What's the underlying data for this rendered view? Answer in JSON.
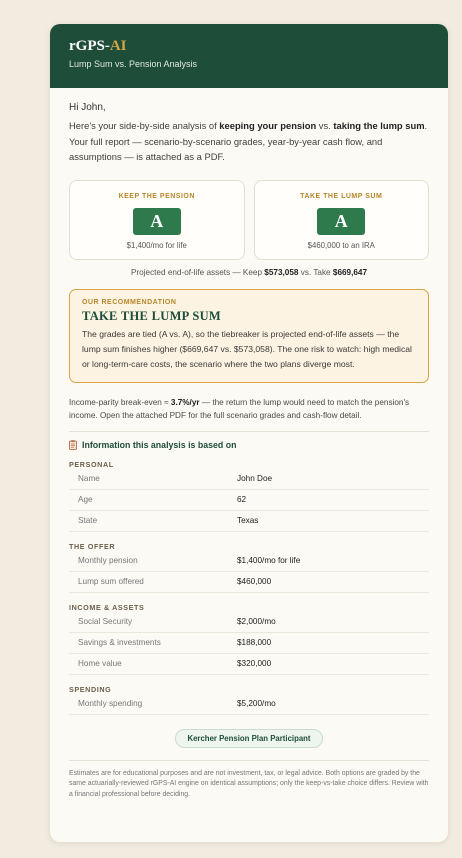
{
  "header": {
    "brand_main": "rGPS-",
    "brand_accent": "AI",
    "subtitle": "Lump Sum vs. Pension Analysis"
  },
  "greeting": "Hi John,",
  "intro": {
    "p1": "Here's your side-by-side analysis of ",
    "b1": "keeping your pension",
    "p2": " vs. ",
    "b2": "taking the lump sum",
    "p3": ". Your full report — scenario-by-scenario grades, year-by-year cash flow, and assumptions — is attached as a PDF."
  },
  "options": [
    {
      "label": "KEEP THE PENSION",
      "grade": "A",
      "sub": "$1,400/mo for life"
    },
    {
      "label": "TAKE THE LUMP SUM",
      "grade": "A",
      "sub": "$460,000 to an IRA"
    }
  ],
  "projected": {
    "prefix": "Projected end-of-life assets — Keep ",
    "keep": "$573,058",
    "mid": " vs. Take ",
    "take": "$669,647"
  },
  "recommendation": {
    "kicker": "OUR RECOMMENDATION",
    "title": "TAKE THE LUMP SUM",
    "body": "The grades are tied (A vs. A), so the tiebreaker is projected end-of-life assets — the lump sum finishes higher ($669,647 vs. $573,058). The one risk to watch: high medical or long-term-care costs, the scenario where the two plans diverge most."
  },
  "parity": {
    "prefix": "Income-parity break-even ≈ ",
    "value": "3.7%/yr",
    "suffix": " — the return the lump would need to match the pension's income. Open the attached PDF for the full scenario grades and cash-flow detail."
  },
  "info": {
    "title": "Information this analysis is based on",
    "sections": [
      {
        "label": "PERSONAL",
        "rows": [
          {
            "k": "Name",
            "v": "John Doe"
          },
          {
            "k": "Age",
            "v": "62"
          },
          {
            "k": "State",
            "v": "Texas"
          }
        ]
      },
      {
        "label": "THE OFFER",
        "rows": [
          {
            "k": "Monthly pension",
            "v": "$1,400/mo for life"
          },
          {
            "k": "Lump sum offered",
            "v": "$460,000"
          }
        ]
      },
      {
        "label": "INCOME & ASSETS",
        "rows": [
          {
            "k": "Social Security",
            "v": "$2,000/mo"
          },
          {
            "k": "Savings & investments",
            "v": "$188,000"
          },
          {
            "k": "Home value",
            "v": "$320,000"
          }
        ]
      },
      {
        "label": "SPENDING",
        "rows": [
          {
            "k": "Monthly spending",
            "v": "$5,200/mo"
          }
        ]
      }
    ]
  },
  "badge": "Kercher Pension Plan Participant",
  "footer": "Estimates are for educational purposes and are not investment, tax, or legal advice. Both options are graded by the same actuarially-reviewed rGPS-AI engine on identical assumptions; only the keep-vs-take choice differs. Review with a financial professional before deciding.",
  "colors": {
    "header_bg": "#1e4d3a",
    "accent_gold": "#d4a546",
    "grade_green": "#2e7a4c",
    "reco_border": "#d9a441"
  }
}
